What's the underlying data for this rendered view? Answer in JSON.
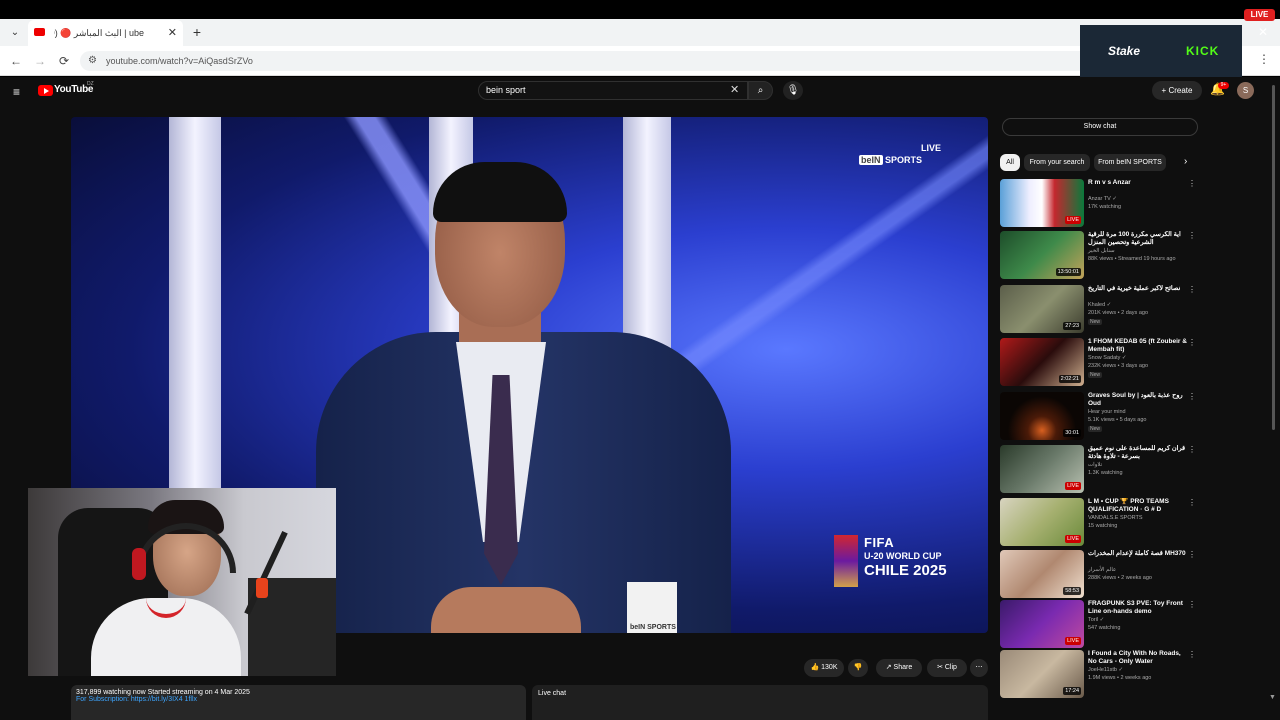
{
  "browser": {
    "tab_title": "ube | البث المباشر 🔴 (269)",
    "new_tab": "+",
    "close_tab": "✕",
    "url": "youtube.com/watch?v=AiQasdSrZVo",
    "tab_dropdown": "⌄",
    "back": "←",
    "forward": "→",
    "reload": "⟳",
    "menu": "⋮"
  },
  "stream_overlay": {
    "ad_stake": "Stake",
    "ad_kick": "KICK",
    "live_badge": "LIVE",
    "ad_close": "✕"
  },
  "youtube": {
    "logo": "YouTube",
    "logo_country": "DZ",
    "search_query": "bein sport",
    "search_clear": "✕",
    "search_icon": "⌕",
    "mic_icon": "🎙",
    "create_label": "+ Create",
    "bell_icon": "🔔",
    "notif_count": "9+",
    "avatar_letter": "S",
    "menu_icon": "≡"
  },
  "video": {
    "bein_live": "LIVE",
    "bein_logo_prefix": "beIN",
    "bein_logo_suffix": "SPORTS",
    "fifa_line1": "FIFA",
    "fifa_line2": "U-20 WORLD CUP",
    "fifa_line3": "CHILE 2025",
    "desk_logo": "beIN SPORTS"
  },
  "actions": {
    "like": "👍 130K",
    "dislike": "👎",
    "share": "↗ Share",
    "clip": "✂ Clip",
    "more": "⋯"
  },
  "info": {
    "line1": "317,899 watching now  Started streaming on 4 Mar 2025",
    "line2": "For Subscription: https://bit.ly/3IX4 1fllx"
  },
  "live_chat_label": "Live chat",
  "sidebar": {
    "show_chat": "Show chat",
    "chips": [
      "All",
      "From your search",
      "From beIN SPORTS"
    ],
    "chip_next": "›",
    "items": [
      {
        "title": "R m v s Anzar",
        "channel": "Anzar TV ✓",
        "meta": "17K watching",
        "badge": "LIVE",
        "badge_type": "live",
        "thumb": "linear-gradient(90deg,#5aa0d8 0%,#eef 35%,#fff 50%,#c4272e 65%,#0a7a3c 100%)"
      },
      {
        "title": "آية الكرسي مكررة 100 مرة للرقية الشرعية وتحصين المنزل",
        "channel": "سنابل الخير",
        "meta": "88K views • Streamed 19 hours ago",
        "badge": "13:50:01",
        "badge_type": "dur",
        "thumb": "linear-gradient(135deg,#1d4d2a,#3e8a4a,#c4a35a)"
      },
      {
        "title": "نصائح لأكبر عملية خيرية في التاريخ",
        "channel": "Khaled ✓",
        "meta": "201K views • 2 days ago",
        "badge": "27:23",
        "badge_type": "dur",
        "thumb": "linear-gradient(135deg,#5b5e4a,#8a8f6e,#3c3d2e)",
        "new": "New"
      },
      {
        "title": "1 FHOM KEDAB 05 (ft Zoubeir & Membah fit)",
        "channel": "Snow Sadaty ✓",
        "meta": "232K views • 3 days ago",
        "badge": "2:02:21",
        "badge_type": "dur",
        "thumb": "linear-gradient(135deg,#b11a1a,#2a0c0c,#d0b090)",
        "new": "New"
      },
      {
        "title": "Graves Soul by | روح عذبة بالعود Oud",
        "channel": "Hear your mind",
        "meta": "5.1K views • 5 days ago",
        "badge": "30:01",
        "badge_type": "dur",
        "thumb": "radial-gradient(circle at 50% 80%,#d86020 0%,#4a1a08 25%,#0b0604 60%)",
        "new": "New"
      },
      {
        "title": "قرآن كريم للمساعدة على نوم عميق بسرعة - تلاوة هادئة",
        "channel": "تلاوات",
        "meta": "1.3K watching",
        "badge": "LIVE",
        "badge_type": "live",
        "thumb": "linear-gradient(135deg,#2a3a2a,#6a7a6a,#b8c0b0)"
      },
      {
        "title": "L M • CUP 🏆 PRO TEAMS QUALIFICATION · G # D",
        "channel": "VANDALS.E SPORTS",
        "meta": "15 watching",
        "badge": "LIVE",
        "badge_type": "live",
        "thumb": "linear-gradient(135deg,#d8d4c0,#a6b070,#6a8a3a)"
      },
      {
        "title": "قصة كاملة لإعدام المخدرات MH370",
        "channel": "عالم الأسرار",
        "meta": "288K views • 2 weeks ago",
        "badge": "58:53",
        "badge_type": "dur",
        "thumb": "linear-gradient(135deg,#e0c8b8,#b08870,#f0e0d0)"
      },
      {
        "title": "FRAGPUNK S3 PVE: Toy Front Line on-hands demo",
        "channel": "Toril ✓",
        "meta": "547 watching",
        "badge": "LIVE",
        "badge_type": "live",
        "thumb": "linear-gradient(135deg,#3a1a6a,#7a2ab0,#c04aa0)"
      },
      {
        "title": "I Found a City With No Roads, No Cars - Only Water",
        "channel": "JoeHe11stb ✓",
        "meta": "1.9M views • 2 weeks ago",
        "badge": "17:24",
        "badge_type": "dur",
        "thumb": "linear-gradient(135deg,#9a8a78,#c8b8a0,#6a5a4a)"
      }
    ]
  }
}
